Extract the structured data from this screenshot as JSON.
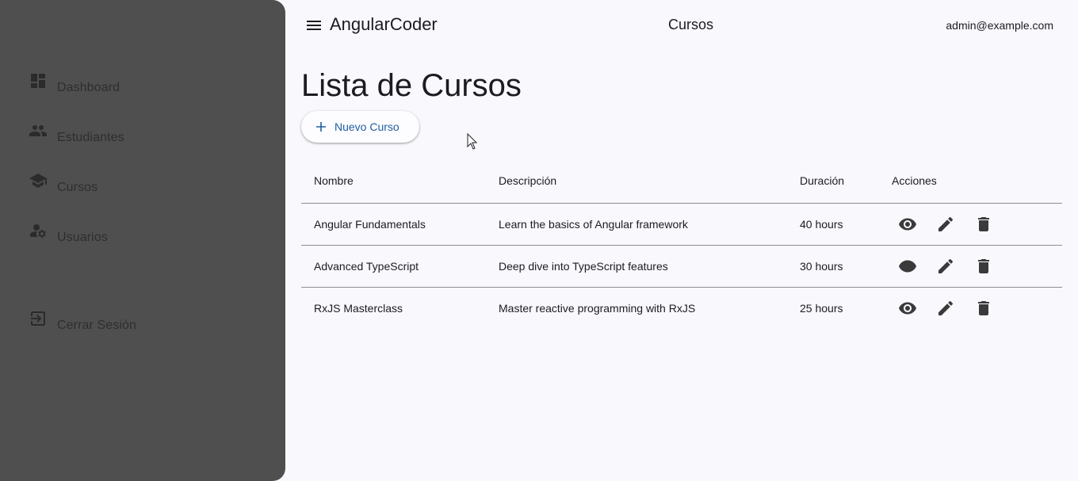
{
  "app": {
    "title": "AngularCoder",
    "section": "Cursos",
    "user_email": "admin@example.com"
  },
  "sidebar": {
    "items": [
      {
        "label": "Dashboard",
        "icon": "dashboard-icon"
      },
      {
        "label": "Estudiantes",
        "icon": "people-icon"
      },
      {
        "label": "Cursos",
        "icon": "school-icon"
      },
      {
        "label": "Usuarios",
        "icon": "manage-accounts-icon"
      }
    ],
    "logout": {
      "label": "Cerrar Sesión",
      "icon": "logout-icon"
    }
  },
  "main": {
    "title": "Lista de Cursos",
    "new_button": {
      "label": "Nuevo Curso",
      "icon": "plus-icon"
    },
    "table": {
      "columns": [
        "Nombre",
        "Descripción",
        "Duración",
        "Acciones"
      ],
      "rows": [
        {
          "name": "Angular Fundamentals",
          "description": "Learn the basics of Angular framework",
          "duration": "40 hours"
        },
        {
          "name": "Advanced TypeScript",
          "description": "Deep dive into TypeScript features",
          "duration": "30 hours"
        },
        {
          "name": "RxJS Masterclass",
          "description": "Master reactive programming with RxJS",
          "duration": "25 hours"
        }
      ],
      "row_actions": [
        "view-icon",
        "edit-icon",
        "delete-icon"
      ]
    }
  },
  "colors": {
    "background": "#f9f8fd",
    "sidebar_overlay": "#4f4f4f",
    "accent": "#1f5fa0",
    "divider": "#8e8e8e"
  }
}
